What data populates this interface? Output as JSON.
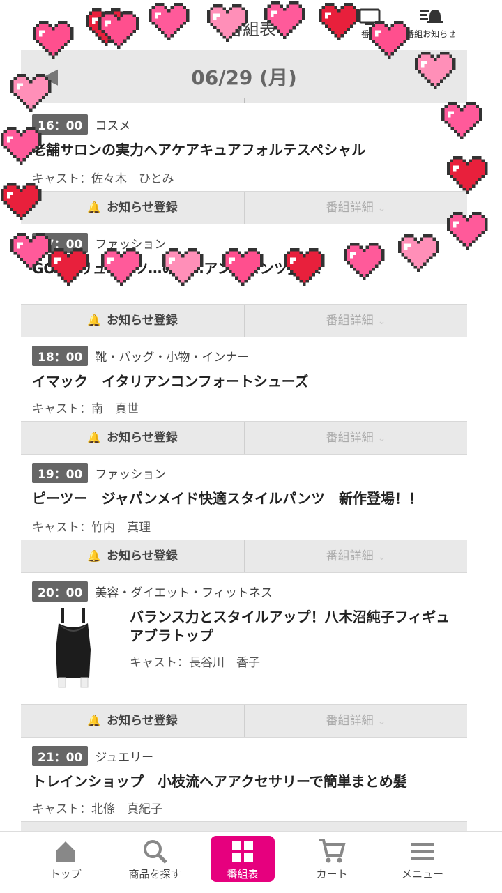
{
  "header": {
    "title": "番組表",
    "tv_button_label": "番組",
    "notify_button_label": "番組お知らせ"
  },
  "datebar": {
    "date": "06/29 (月)",
    "prev_arrow": "◀"
  },
  "actions": {
    "notify_label": "お知らせ登録",
    "detail_label": "番組詳細"
  },
  "programs": [
    {
      "time": "16：00",
      "category": "コスメ",
      "title": "老舗サロンの実力ヘアケアキュアフォルテスペシャル",
      "cast": "キャスト：佐々木　ひとみ"
    },
    {
      "time": "17：00",
      "category": "ファッション",
      "title": "GOGOリュ…ーツ…の決…アン…パンツ登場！",
      "cast": ""
    },
    {
      "time": "18：00",
      "category": "靴・バッグ・小物・インナー",
      "title": "イマック　イタリアンコンフォートシューズ",
      "cast": "キャスト：南　真世"
    },
    {
      "time": "19：00",
      "category": "ファッション",
      "title": "ピーツー　ジャパンメイド快適スタイルパンツ　新作登場！！",
      "cast": "キャスト：竹内　真理"
    },
    {
      "time": "20：00",
      "category": "美容・ダイエット・フィットネス",
      "title": "バランス力とスタイルアップ！八木沼純子フィギュアブラトップ",
      "cast": "キャスト：長谷川　香子"
    },
    {
      "time": "21：00",
      "category": "ジュエリー",
      "title": "トレインショップ　小枝流ヘアアクセサリーで簡単まとめ髪",
      "cast": "キャスト：北條　真紀子"
    }
  ],
  "tabbar": {
    "home": "トップ",
    "search": "商品を探す",
    "schedule": "番組表",
    "cart": "カート",
    "menu": "メニュー"
  },
  "colors": {
    "accent": "#e6007e",
    "bell": "#f0b400",
    "heart_pink": "#ff5a9a",
    "heart_red": "#e8203c"
  }
}
